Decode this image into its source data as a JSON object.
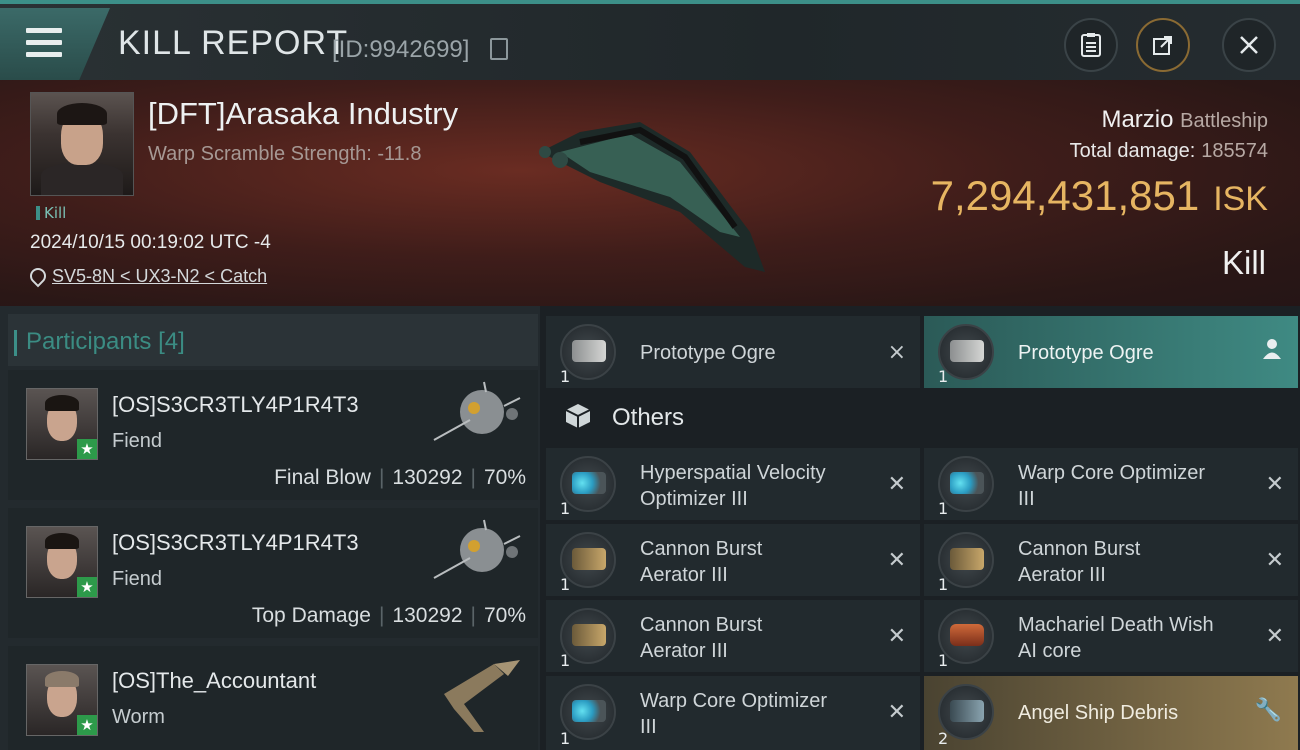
{
  "header": {
    "title": "KILL REPORT",
    "report_id": "[ID:9942699]",
    "icons": [
      "menu-icon",
      "copy-icon",
      "clipboard-icon",
      "share-icon",
      "close-icon"
    ]
  },
  "victim": {
    "name": "[DFT]Arasaka Industry",
    "subtitle": "Warp Scramble Strength: -11.8",
    "tag": "Kill",
    "datetime": "2024/10/15 00:19:02 UTC -4",
    "location": "SV5-8N < UX3-N2 < Catch"
  },
  "summary": {
    "attacker_name": "Marzio",
    "attacker_class": "Battleship",
    "total_damage_label": "Total damage:",
    "total_damage": "185574",
    "isk_value": "7,294,431,851",
    "isk_unit": "ISK",
    "result": "Kill"
  },
  "participants": {
    "title": "Participants",
    "count": "[4]",
    "list": [
      {
        "name": "[OS]S3CR3TLY4P1R4T3",
        "ship": "Fiend",
        "role": "Final Blow",
        "damage": "130292",
        "percent": "70%"
      },
      {
        "name": "[OS]S3CR3TLY4P1R4T3",
        "ship": "Fiend",
        "role": "Top Damage",
        "damage": "130292",
        "percent": "70%"
      },
      {
        "name": "[OS]The_Accountant",
        "ship": "Worm"
      }
    ]
  },
  "drones": [
    {
      "qty": "1",
      "name": "Prototype  Ogre",
      "action": "×"
    },
    {
      "qty": "1",
      "name": "Prototype  Ogre",
      "action": "person"
    }
  ],
  "others_label": "Others",
  "items": [
    {
      "qty": "1",
      "name1": "Hyperspatial Velocity",
      "name2": "Optimizer III"
    },
    {
      "qty": "1",
      "name1": "Warp Core Optimizer",
      "name2": "III"
    },
    {
      "qty": "1",
      "name1": "Cannon Burst",
      "name2": "Aerator III"
    },
    {
      "qty": "1",
      "name1": "Cannon Burst",
      "name2": "Aerator III"
    },
    {
      "qty": "1",
      "name1": "Cannon Burst",
      "name2": "Aerator III"
    },
    {
      "qty": "1",
      "name1": "Machariel Death Wish",
      "name2": "AI core"
    },
    {
      "qty": "1",
      "name1": "Warp Core Optimizer",
      "name2": "III"
    },
    {
      "qty": "2",
      "name1": "Angel Ship Debris",
      "name2": ""
    }
  ],
  "colors": {
    "accent": "#3c8f88",
    "isk": "#e6b562",
    "gold_row": "#8f7a4f"
  }
}
